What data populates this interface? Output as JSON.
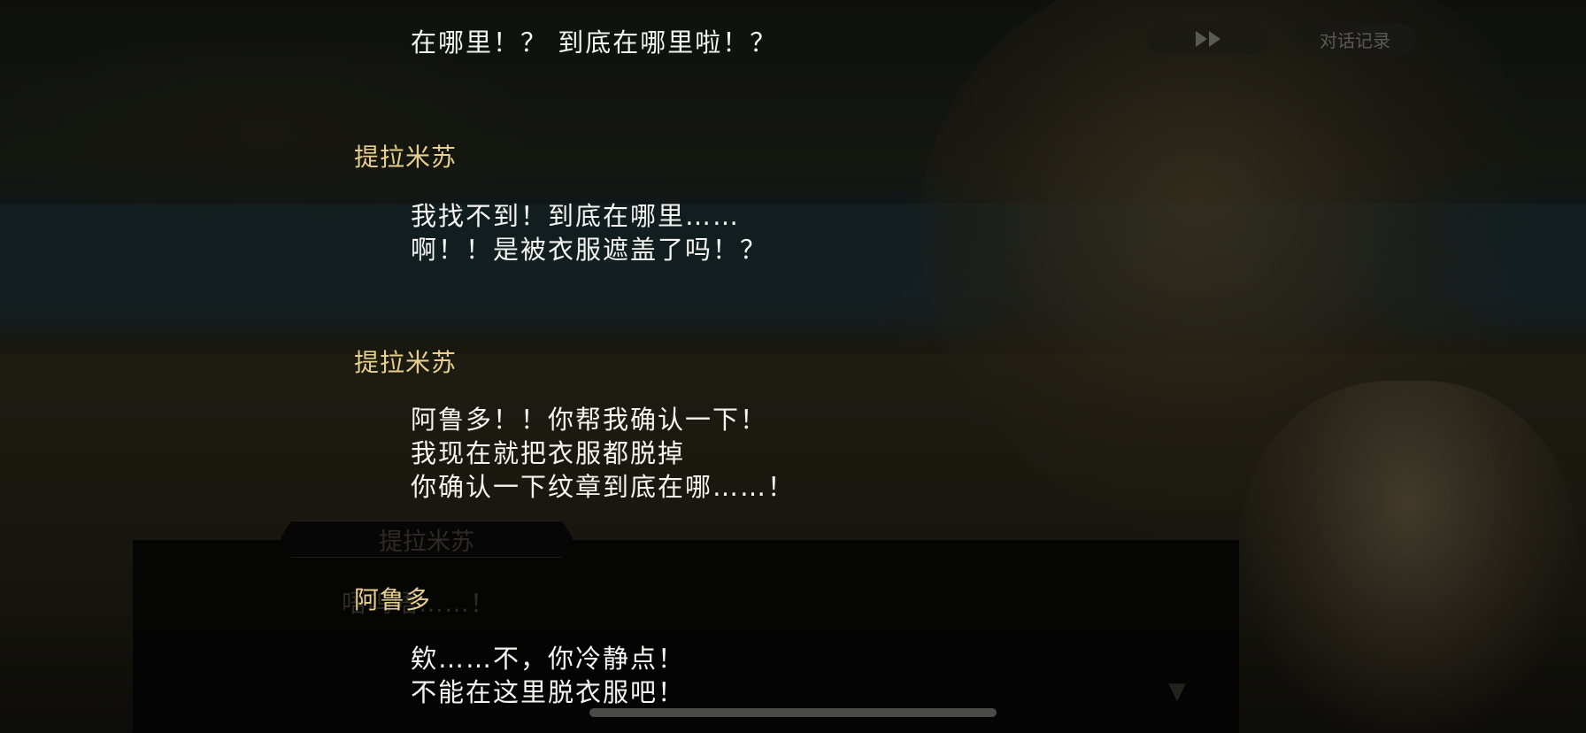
{
  "controls": {
    "fast_forward_label": "",
    "log_label": "对话记录"
  },
  "dialog_box": {
    "speaker": "提拉米苏",
    "text": "唔呜唔……！"
  },
  "log": {
    "entries": [
      {
        "lines": [
          "在哪里！？ 到底在哪里啦！？"
        ]
      },
      {
        "speaker": "提拉米苏",
        "lines": [
          "我找不到！到底在哪里……",
          "啊！！是被衣服遮盖了吗！？"
        ]
      },
      {
        "speaker": "提拉米苏",
        "lines": [
          "阿鲁多！！你帮我确认一下！",
          "我现在就把衣服都脱掉",
          "你确认一下纹章到底在哪……！"
        ]
      },
      {
        "speaker": "阿鲁多",
        "lines": [
          "欸……不，你冷静点！",
          "不能在这里脱衣服吧！"
        ]
      }
    ]
  },
  "colors": {
    "speaker": "#e6cf8e",
    "text": "#f4f4f0"
  }
}
